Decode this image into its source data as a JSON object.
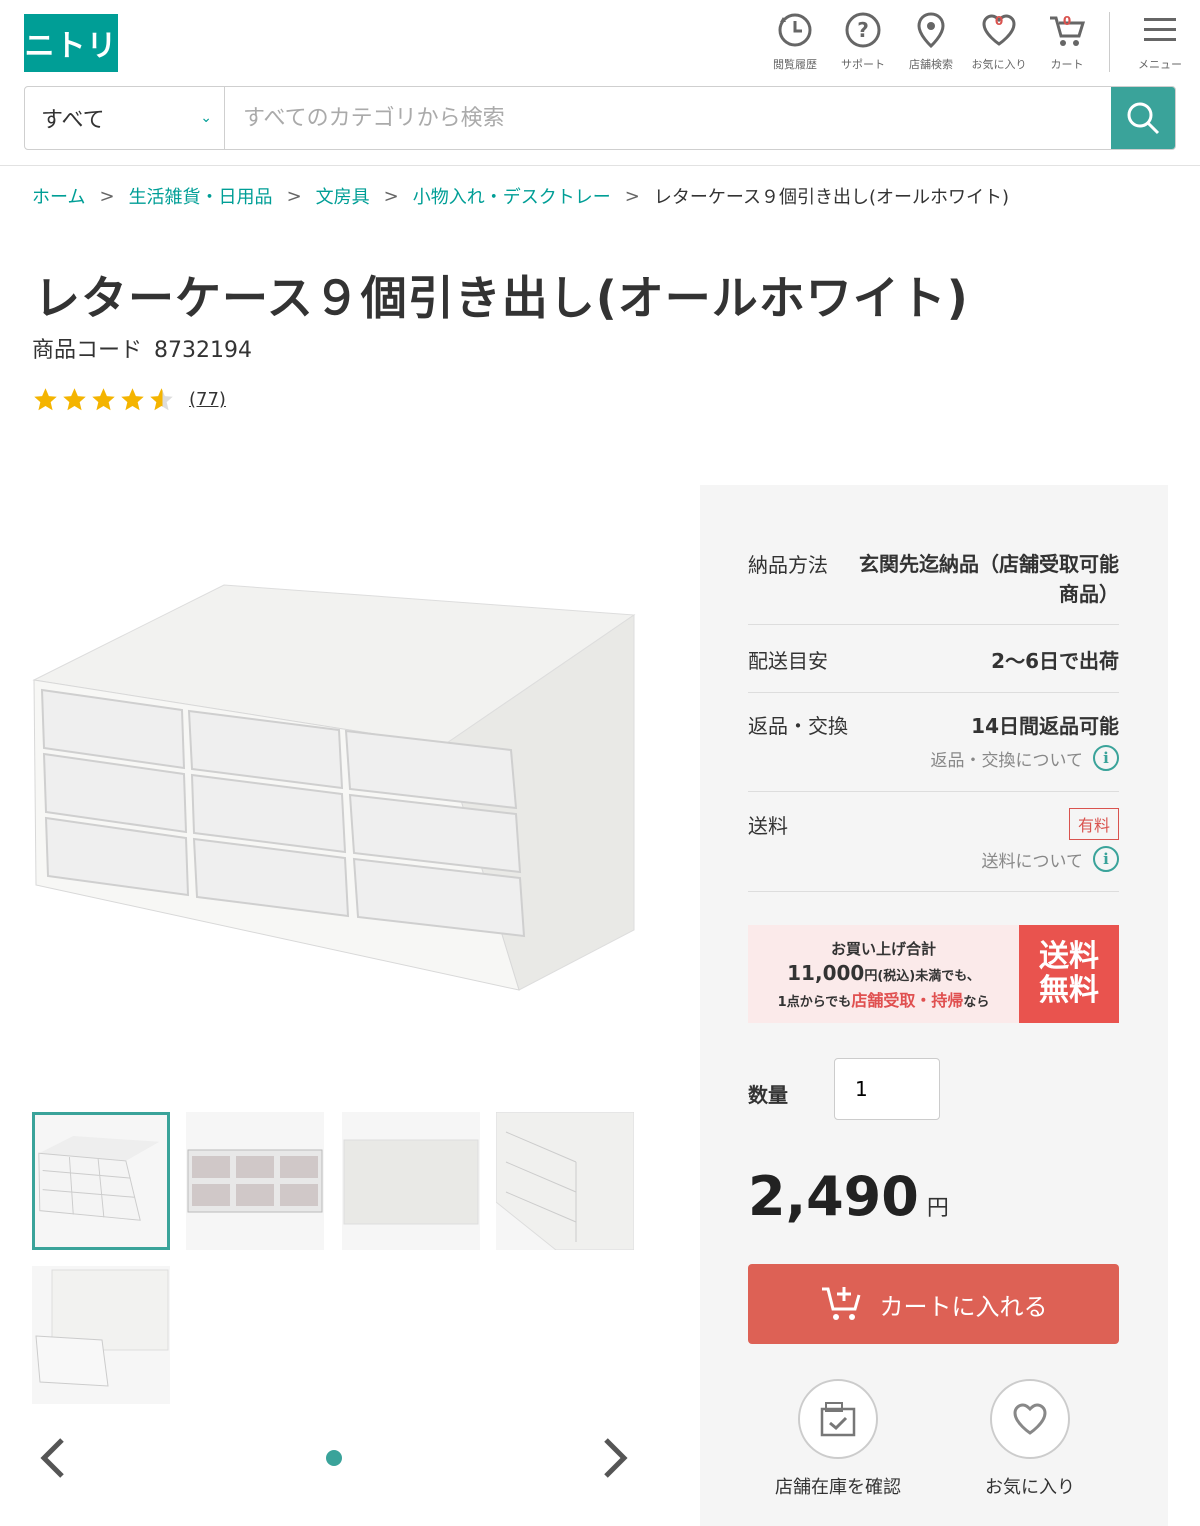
{
  "header": {
    "logo": "ニトリ",
    "icons": [
      {
        "name": "history",
        "label": "閲覧履歴"
      },
      {
        "name": "support",
        "label": "サポート"
      },
      {
        "name": "store",
        "label": "店舗検索"
      },
      {
        "name": "favorite",
        "label": "お気に入り",
        "badge": "0"
      },
      {
        "name": "cart",
        "label": "カート",
        "badge": "0"
      }
    ],
    "menu_label": "メニュー"
  },
  "search": {
    "category": "すべて",
    "placeholder": "すべてのカテゴリから検索"
  },
  "breadcrumb": [
    "ホーム",
    "生活雑貨・日用品",
    "文房具",
    "小物入れ・デスクトレー",
    "レターケース９個引き出し(オールホワイト)"
  ],
  "breadcrumb_sep": ">",
  "product": {
    "title": "レターケース９個引き出し(オールホワイト)",
    "code_label": "商品コード",
    "code": "8732194",
    "rating": 4.5,
    "review_count": "(77)",
    "price": "2,490",
    "currency": "円"
  },
  "delivery": {
    "method_label": "納品方法",
    "method_value": "玄関先迄納品（店舗受取可能商品）",
    "schedule_label": "配送目安",
    "schedule_value": "2〜6日で出荷",
    "return_label": "返品・交換",
    "return_value": "14日間返品可能",
    "return_link": "返品・交換について",
    "shipping_label": "送料",
    "shipping_badge": "有料",
    "shipping_link": "送料について"
  },
  "promo": {
    "line1": "お買い上げ合計",
    "line2_amount": "11,000",
    "line2_unit": "円(税込)",
    "line2_rest": "未満でも、",
    "line3_pre": "1点からでも",
    "line3_red": "店舗受取・持帰",
    "line3_post": "なら",
    "badge_l1": "送料",
    "badge_l2": "無料"
  },
  "quantity": {
    "label": "数量",
    "value": "1"
  },
  "cart_button": "カートに入れる",
  "actions": {
    "stock": "店舗在庫を確認",
    "favorite": "お気に入り"
  },
  "colors": {
    "brand": "#009e96",
    "cart": "#dd6155",
    "promo": "#e9534e"
  }
}
